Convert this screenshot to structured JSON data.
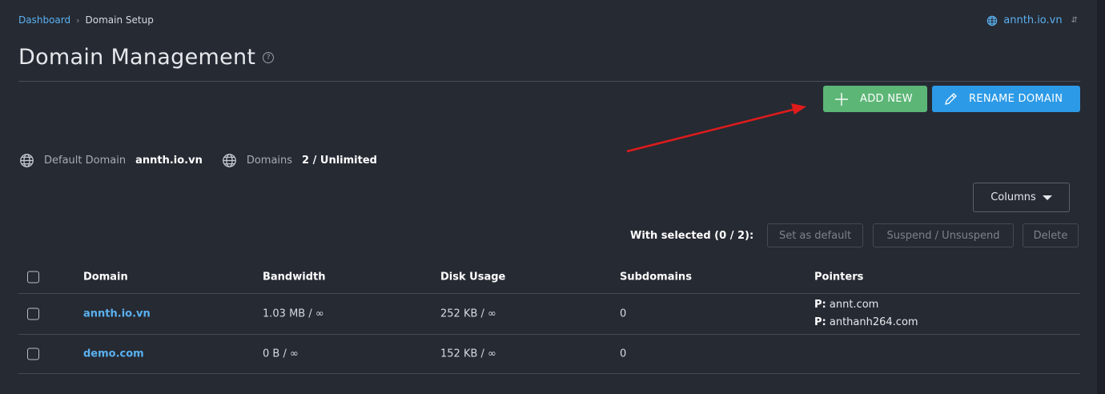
{
  "breadcrumb": {
    "home": "Dashboard",
    "separator": "›",
    "current": "Domain Setup"
  },
  "domain_selector": {
    "label": "annth.io.vn",
    "icon": "globe-icon"
  },
  "page": {
    "title": "Domain Management",
    "help_glyph": "?"
  },
  "actions": {
    "add_new": "ADD NEW",
    "rename_domain": "RENAME DOMAIN"
  },
  "info": {
    "default_domain_label": "Default Domain",
    "default_domain_value": "annth.io.vn",
    "domains_label": "Domains",
    "domains_value": "2 / Unlimited"
  },
  "columns_button": "Columns",
  "bulk": {
    "with_selected": "With selected (0 / 2):",
    "set_default": "Set as default",
    "suspend": "Suspend / Unsuspend",
    "delete": "Delete"
  },
  "table": {
    "headers": {
      "domain": "Domain",
      "bandwidth": "Bandwidth",
      "disk": "Disk Usage",
      "subdomains": "Subdomains",
      "pointers": "Pointers"
    },
    "rows": [
      {
        "domain": "annth.io.vn",
        "bandwidth": "1.03 MB / ∞",
        "disk": "252 KB / ∞",
        "subdomains": "0",
        "pointers": [
          {
            "prefix": "P:",
            "value": "annt.com"
          },
          {
            "prefix": "P:",
            "value": "anthanh264.com"
          }
        ]
      },
      {
        "domain": "demo.com",
        "bandwidth": "0 B / ∞",
        "disk": "152 KB / ∞",
        "subdomains": "0",
        "pointers": []
      }
    ]
  },
  "colors": {
    "background": "#262a33",
    "link": "#5ab1f0",
    "add_green": "#5cb676",
    "rename_blue": "#2c9ae6",
    "annotation_arrow": "#e01b1b"
  }
}
